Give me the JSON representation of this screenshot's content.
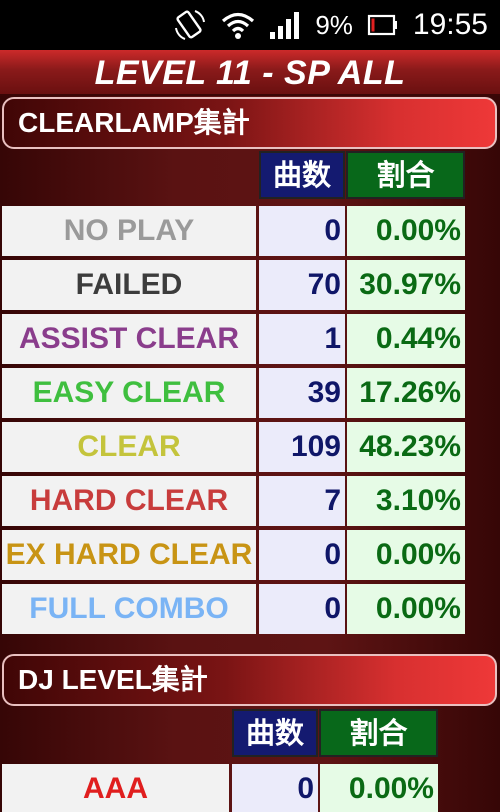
{
  "status_bar": {
    "battery_percent": "9%",
    "time": "19:55",
    "icons": [
      "rotate-lock-icon",
      "wifi-icon",
      "signal-icon",
      "battery-icon"
    ]
  },
  "page_title": "LEVEL 11 - SP ALL",
  "clearlamp": {
    "title": "CLEARLAMP集計",
    "col_count": "曲数",
    "col_ratio": "割合",
    "rows": [
      {
        "label": "NO PLAY",
        "count": "0",
        "ratio": "0.00%",
        "color": "#9a9a9a"
      },
      {
        "label": "FAILED",
        "count": "70",
        "ratio": "30.97%",
        "color": "#3c3c3c"
      },
      {
        "label": "ASSIST CLEAR",
        "count": "1",
        "ratio": "0.44%",
        "color": "#8a3d8c"
      },
      {
        "label": "EASY CLEAR",
        "count": "39",
        "ratio": "17.26%",
        "color": "#3fbf3f"
      },
      {
        "label": "CLEAR",
        "count": "109",
        "ratio": "48.23%",
        "color": "#c4c43c"
      },
      {
        "label": "HARD CLEAR",
        "count": "7",
        "ratio": "3.10%",
        "color": "#c83c3c"
      },
      {
        "label": "EX HARD CLEAR",
        "count": "0",
        "ratio": "0.00%",
        "color": "#c89414"
      },
      {
        "label": "FULL COMBO",
        "count": "0",
        "ratio": "0.00%",
        "color": "#7ab4f5"
      }
    ]
  },
  "djlevel": {
    "title": "DJ LEVEL集計",
    "col_count": "曲数",
    "col_ratio": "割合",
    "rows": [
      {
        "label": "AAA",
        "count": "0",
        "ratio": "0.00%",
        "color": "#e01e1e"
      }
    ]
  },
  "colors": {
    "count_header": "#141a70",
    "ratio_header": "#08681a",
    "count_text": "#0f1668",
    "ratio_text": "#0a6a14"
  }
}
